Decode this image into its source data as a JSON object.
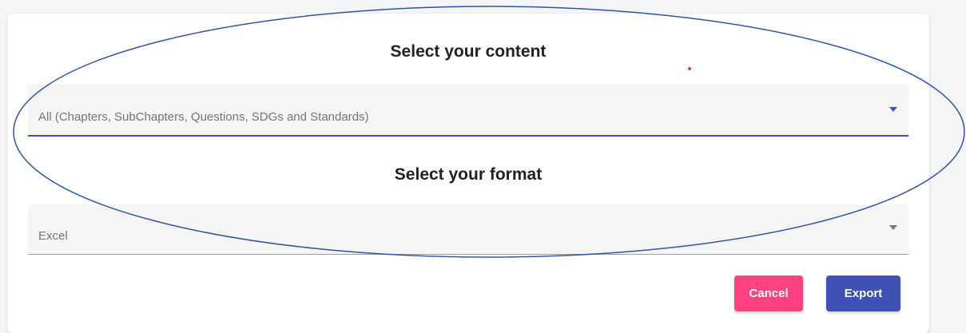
{
  "content_section": {
    "heading": "Select your content",
    "selected_value": "All (Chapters, SubChapters, Questions, SDGs and Standards)"
  },
  "format_section": {
    "heading": "Select your format",
    "selected_value": "Excel"
  },
  "actions": {
    "cancel_label": "Cancel",
    "export_label": "Export"
  },
  "colors": {
    "primary": "#3f51b5",
    "accent": "#ff4081",
    "annotation_stroke": "#2f55a4",
    "annotation_dot": "#e53935"
  },
  "icons": [
    "dropdown-arrow-icon",
    "dropdown-arrow-icon"
  ]
}
